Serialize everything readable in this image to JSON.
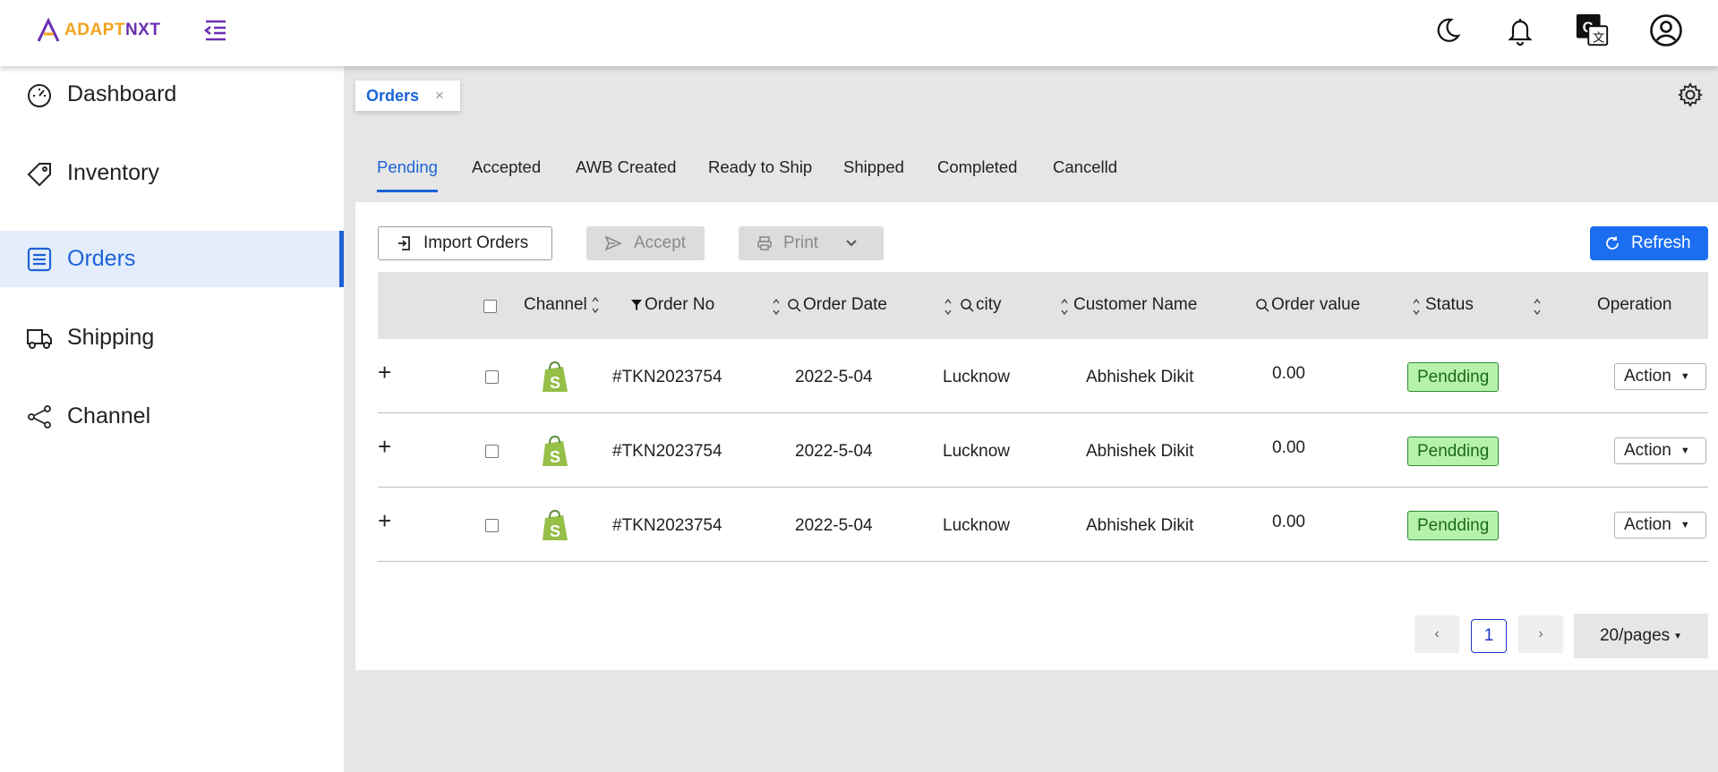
{
  "brand": {
    "logo_a": "ADAPT",
    "logo_b": "NXT"
  },
  "header_icons": [
    "dark-mode-icon",
    "notification-bell-icon",
    "translate-icon",
    "user-account-icon"
  ],
  "sidebar": {
    "items": [
      {
        "label": "Dashboard",
        "icon": "dashboard-gauge-icon"
      },
      {
        "label": "Inventory",
        "icon": "tag-icon"
      },
      {
        "label": "Orders",
        "icon": "list-document-icon"
      },
      {
        "label": "Shipping",
        "icon": "truck-icon"
      },
      {
        "label": "Channel",
        "icon": "share-icon"
      }
    ],
    "active": "Orders"
  },
  "page_tab": {
    "label": "Orders",
    "close": "×"
  },
  "status_tabs": [
    "Pending",
    "Accepted",
    "AWB Created",
    "Ready to Ship",
    "Shipped",
    "Completed",
    "Cancelld"
  ],
  "active_status_tab": "Pending",
  "toolbar": {
    "import_label": "Import Orders",
    "accept_label": "Accept",
    "print_label": "Print",
    "refresh_label": "Refresh"
  },
  "table": {
    "columns": {
      "channel": "Channel",
      "order_no": "Order No",
      "order_date": "Order Date",
      "city": "city",
      "customer_name": "Customer Name",
      "order_value": "Order value",
      "status": "Status",
      "operation": "Operation"
    },
    "rows": [
      {
        "order_no": "#TKN2023754",
        "order_date": "2022-5-04",
        "city": "Lucknow",
        "customer_name": "Abhishek Dikit",
        "order_value": "0.00",
        "status": "Pendding",
        "action": "Action"
      },
      {
        "order_no": "#TKN2023754",
        "order_date": "2022-5-04",
        "city": "Lucknow",
        "customer_name": "Abhishek Dikit",
        "order_value": "0.00",
        "status": "Pendding",
        "action": "Action"
      },
      {
        "order_no": "#TKN2023754",
        "order_date": "2022-5-04",
        "city": "Lucknow",
        "customer_name": "Abhishek Dikit",
        "order_value": "0.00",
        "status": "Pendding",
        "action": "Action"
      }
    ]
  },
  "pagination": {
    "current_page": "1",
    "page_size": "20/pages"
  },
  "colors": {
    "accent": "#1b63d6",
    "refresh_button": "#1b6ef0",
    "status_badge_bg": "#b7f2ad",
    "shopify_green": "#95bf47"
  }
}
